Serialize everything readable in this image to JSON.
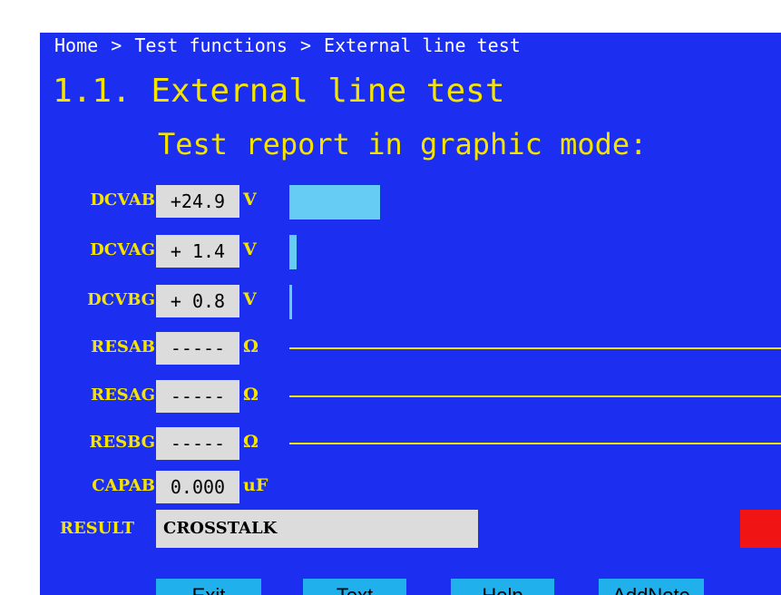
{
  "breadcrumb": {
    "items": [
      "Home",
      "Test functions",
      "External line test"
    ],
    "separator": ">"
  },
  "title": "1.1. External line test",
  "subtitle": "Test report in graphic mode:",
  "colors": {
    "background": "#1c2ff0",
    "text_yellow": "#f5e400",
    "value_box": "#dcdcdc",
    "bar": "#66ccf4",
    "result_indicator": "#f01414",
    "button": "#20b0ec"
  },
  "measurements": [
    {
      "label": "DCVAB",
      "value": "+24.9",
      "unit": "V",
      "kind": "bar",
      "level": 0.4
    },
    {
      "label": "DCVAG",
      "value": "+ 1.4",
      "unit": "V",
      "kind": "bar",
      "level": 0.03
    },
    {
      "label": "DCVBG",
      "value": "+ 0.8",
      "unit": "V",
      "kind": "bar",
      "level": 0.01
    },
    {
      "label": "RESAB",
      "value": "-----",
      "unit": "Ω",
      "kind": "line"
    },
    {
      "label": "RESAG",
      "value": "-----",
      "unit": "Ω",
      "kind": "line"
    },
    {
      "label": "RESBG",
      "value": "-----",
      "unit": "Ω",
      "kind": "line"
    },
    {
      "label": "CAPAB",
      "value": "0.000",
      "unit": "uF",
      "kind": "none"
    }
  ],
  "result": {
    "label": "RESULT",
    "value": "CROSSTALK",
    "indicator": "red"
  },
  "buttons": [
    {
      "label": "Exit"
    },
    {
      "label": "Text"
    },
    {
      "label": "Help"
    },
    {
      "label": "AddNote"
    }
  ]
}
